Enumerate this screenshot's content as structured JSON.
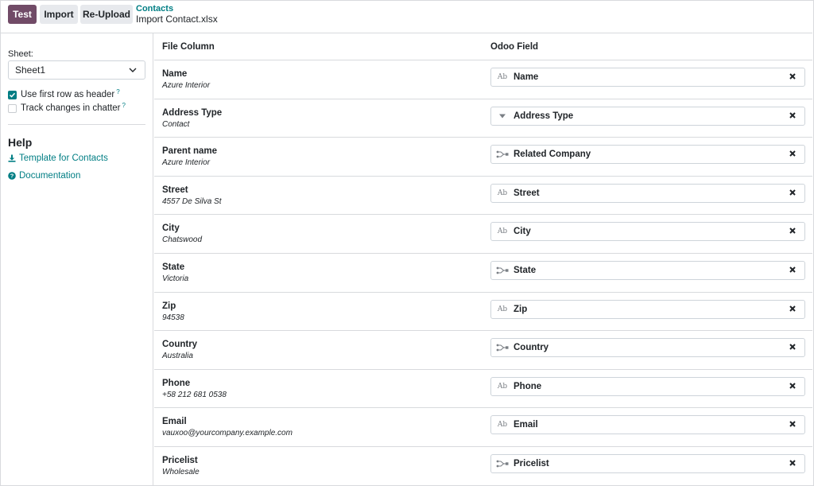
{
  "toolbar": {
    "test_label": "Test",
    "import_label": "Import",
    "reupload_label": "Re-Upload"
  },
  "breadcrumb": {
    "parent": "Contacts",
    "current": "Import Contact.xlsx"
  },
  "sidebar": {
    "sheet_label": "Sheet:",
    "sheet_value": "Sheet1",
    "options": [
      {
        "label": "Use first row as header",
        "checked": true,
        "help": "?"
      },
      {
        "label": "Track changes in chatter",
        "checked": false,
        "help": "?"
      }
    ],
    "help_title": "Help",
    "links": [
      {
        "label": "Template for Contacts",
        "icon": "download-icon"
      },
      {
        "label": "Documentation",
        "icon": "question-circle-icon"
      }
    ]
  },
  "table": {
    "headers": {
      "file_column": "File Column",
      "odoo_field": "Odoo Field"
    },
    "rows": [
      {
        "name": "Name",
        "sample": "Azure Interior",
        "field": "Name",
        "field_icon": "char-icon"
      },
      {
        "name": "Address Type",
        "sample": "Contact",
        "field": "Address Type",
        "field_icon": "selection-icon"
      },
      {
        "name": "Parent name",
        "sample": "Azure Interior",
        "field": "Related Company",
        "field_icon": "relation-icon"
      },
      {
        "name": "Street",
        "sample": "4557 De Silva St",
        "field": "Street",
        "field_icon": "char-icon"
      },
      {
        "name": "City",
        "sample": "Chatswood",
        "field": "City",
        "field_icon": "char-icon"
      },
      {
        "name": "State",
        "sample": "Victoria",
        "field": "State",
        "field_icon": "relation-icon"
      },
      {
        "name": "Zip",
        "sample": "94538",
        "field": "Zip",
        "field_icon": "char-icon"
      },
      {
        "name": "Country",
        "sample": "Australia",
        "field": "Country",
        "field_icon": "relation-icon"
      },
      {
        "name": "Phone",
        "sample": "+58 212 681 0538",
        "field": "Phone",
        "field_icon": "char-icon"
      },
      {
        "name": "Email",
        "sample": "vauxoo@yourcompany.example.com",
        "field": "Email",
        "field_icon": "char-icon"
      },
      {
        "name": "Pricelist",
        "sample": "Wholesale",
        "field": "Pricelist",
        "field_icon": "relation-icon"
      }
    ]
  },
  "icons": {
    "char_text": "Ab"
  },
  "colors": {
    "primary": "#714b67",
    "link": "#017e84",
    "secondary_button": "#e7e9ed",
    "border": "#d8dadd"
  }
}
